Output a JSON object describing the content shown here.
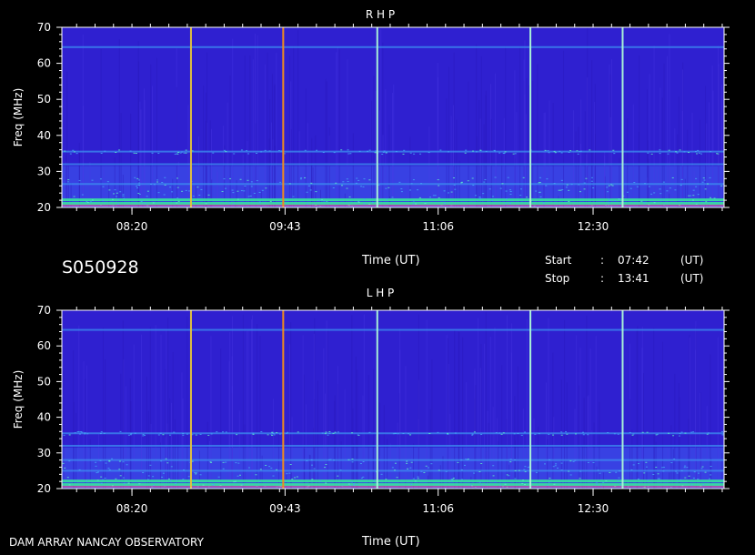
{
  "header": {
    "obs_id": "S050928",
    "start_label": "Start",
    "stop_label": "Stop",
    "colon": ":",
    "start_time": "07:42",
    "stop_time": "13:41",
    "unit": "(UT)"
  },
  "footer": {
    "observatory": "DAM ARRAY   NANCAY OBSERVATORY",
    "xlabel": "Time (UT)"
  },
  "chart_data": [
    {
      "type": "heatmap",
      "title": "R H P",
      "xlabel": "Time (UT)",
      "ylabel": "Freq (MHz)",
      "x_ticks": [
        "08:20",
        "09:43",
        "11:06",
        "12:30"
      ],
      "x_tick_minutes": [
        500,
        583,
        666,
        750
      ],
      "xlim_minutes": [
        462,
        821
      ],
      "y_ticks": [
        20,
        30,
        40,
        50,
        60,
        70
      ],
      "ylim": [
        20,
        70
      ],
      "bands_mhz": [
        21,
        22,
        26.5,
        32,
        35.5,
        64.5
      ],
      "events": [
        {
          "time_min": 532,
          "color": "#e0c040"
        },
        {
          "time_min": 582,
          "color": "#f08a1e"
        },
        {
          "time_min": 633,
          "color": "#a8f0d8"
        },
        {
          "time_min": 716,
          "color": "#a8f0d8"
        },
        {
          "time_min": 766,
          "color": "#a8f0d8"
        }
      ],
      "colors": {
        "background": "#2f20d0",
        "band": "#3c8df0",
        "hot": "#36e6a0"
      }
    },
    {
      "type": "heatmap",
      "title": "L H P",
      "xlabel": "Time (UT)",
      "ylabel": "Freq (MHz)",
      "x_ticks": [
        "08:20",
        "09:43",
        "11:06",
        "12:30"
      ],
      "x_tick_minutes": [
        500,
        583,
        666,
        750
      ],
      "xlim_minutes": [
        462,
        821
      ],
      "y_ticks": [
        20,
        30,
        40,
        50,
        60,
        70
      ],
      "ylim": [
        20,
        70
      ],
      "bands_mhz": [
        21,
        22,
        25,
        28,
        32,
        35.5,
        64.5
      ],
      "events": [
        {
          "time_min": 532,
          "color": "#e0c040"
        },
        {
          "time_min": 582,
          "color": "#f08a1e"
        },
        {
          "time_min": 633,
          "color": "#a8f0d8"
        },
        {
          "time_min": 716,
          "color": "#a8f0d8"
        },
        {
          "time_min": 766,
          "color": "#a8f0d8"
        }
      ],
      "colors": {
        "background": "#2f20d0",
        "band": "#3c8df0",
        "hot": "#36e6a0"
      }
    }
  ]
}
